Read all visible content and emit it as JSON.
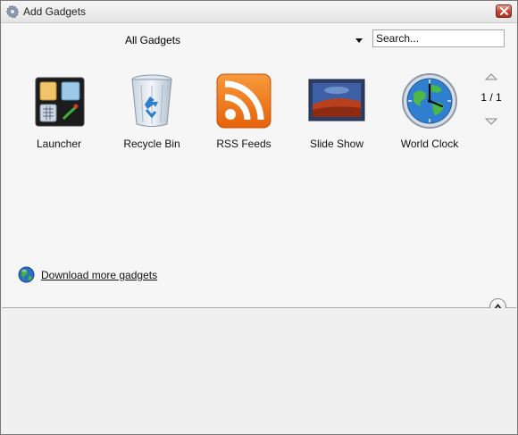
{
  "window": {
    "title": "Add Gadgets",
    "title_icon": "gear-icon",
    "close_icon": "close-icon"
  },
  "toolbar": {
    "filter_value": "All Gadgets",
    "search_placeholder": "Search..."
  },
  "gadgets": [
    {
      "label": "Launcher",
      "icon": "launcher-icon"
    },
    {
      "label": "Recycle Bin",
      "icon": "recycle-bin-icon"
    },
    {
      "label": "RSS Feeds",
      "icon": "rss-icon"
    },
    {
      "label": "Slide Show",
      "icon": "slide-show-icon"
    },
    {
      "label": "World Clock",
      "icon": "world-clock-icon"
    }
  ],
  "pager": {
    "text": "1 / 1"
  },
  "footer": {
    "download_link": "Download more gadgets",
    "globe_icon": "globe-icon"
  },
  "colors": {
    "rss_orange": "#f07a1a",
    "close_red": "#c5422f",
    "globe_blue": "#2a6fc0"
  }
}
